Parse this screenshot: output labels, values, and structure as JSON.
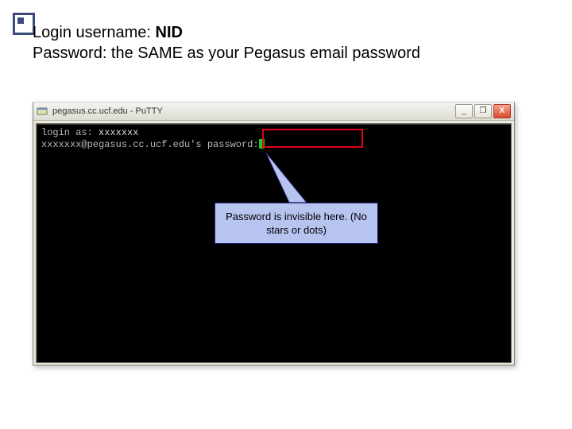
{
  "headline": {
    "line1a": "Login username: ",
    "line1b": "NID",
    "line2": "Password: the SAME as your Pegasus email password"
  },
  "window": {
    "title": "pegasus.cc.ucf.edu - PuTTY",
    "buttons": {
      "min": "_",
      "max": "❐",
      "close": "X"
    }
  },
  "terminal": {
    "line1_label": "login as: ",
    "line1_value": "xxxxxxx",
    "line2": "xxxxxxx@pegasus.cc.ucf.edu's password:"
  },
  "callout": {
    "text": "Password is invisible here. (No stars or dots)"
  }
}
